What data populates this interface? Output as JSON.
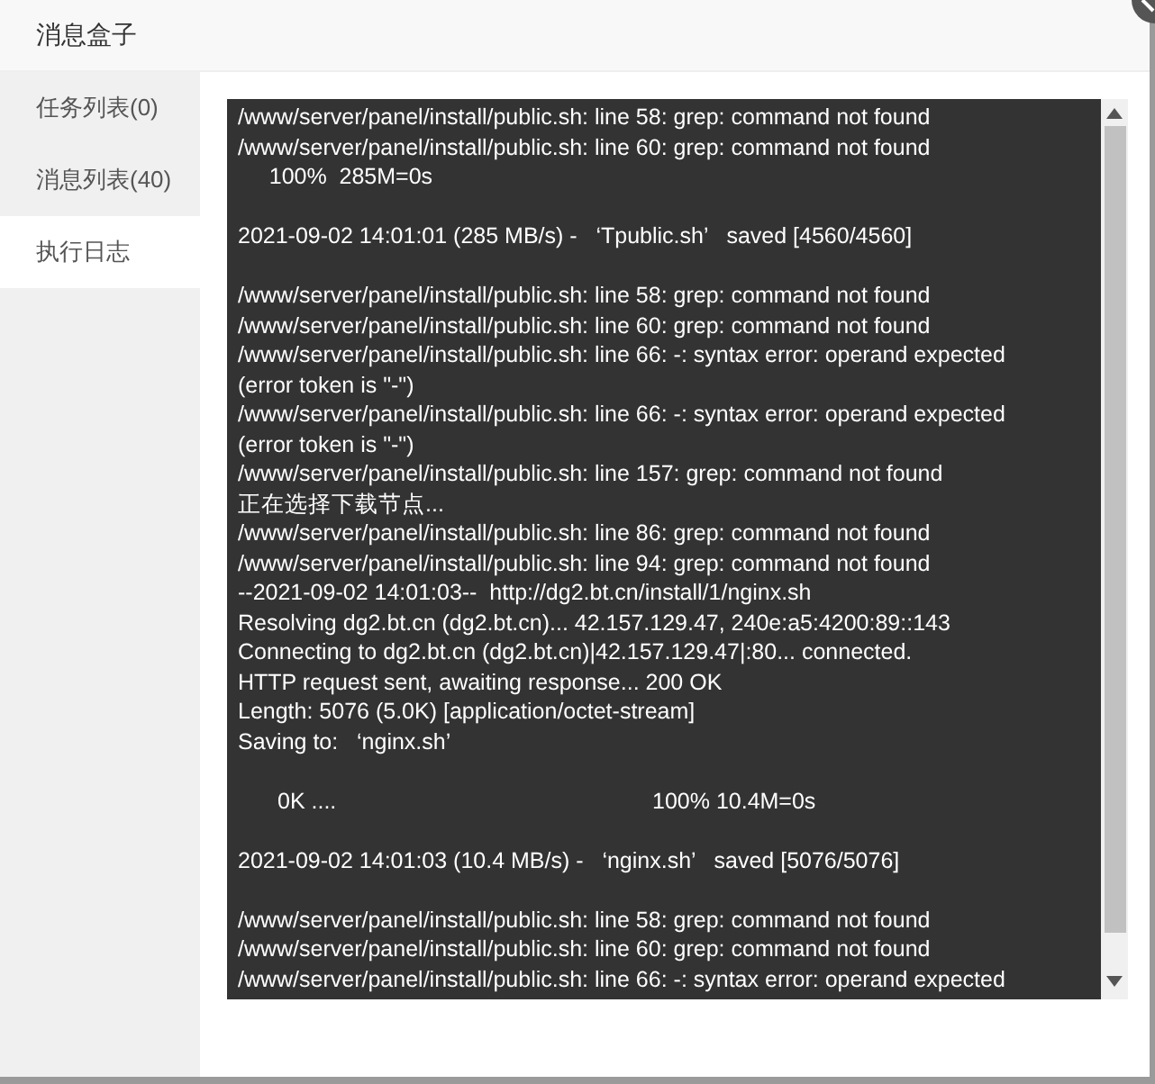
{
  "dialog": {
    "title": "消息盒子"
  },
  "sidebar": {
    "items": [
      {
        "label": "任务列表(0)",
        "selected": false
      },
      {
        "label": "消息列表(40)",
        "selected": false
      },
      {
        "label": "执行日志",
        "selected": true
      }
    ]
  },
  "log": {
    "blocks": [
      [
        "/www/server/panel/install/public.sh: line 58: grep: command not found",
        "/www/server/panel/install/public.sh: line 60: grep: command not found",
        "     100%  285M=0s"
      ],
      [
        "2021-09-02 14:01:01 (285 MB/s) -   ‘Tpublic.sh’   saved [4560/4560]"
      ],
      [
        "/www/server/panel/install/public.sh: line 58: grep: command not found",
        "/www/server/panel/install/public.sh: line 60: grep: command not found",
        "/www/server/panel/install/public.sh: line 66: -: syntax error: operand expected",
        "(error token is \"-\")",
        "/www/server/panel/install/public.sh: line 66: -: syntax error: operand expected",
        "(error token is \"-\")",
        "/www/server/panel/install/public.sh: line 157: grep: command not found",
        "正在选择下载节点...",
        "/www/server/panel/install/public.sh: line 86: grep: command not found",
        "/www/server/panel/install/public.sh: line 94: grep: command not found",
        "--2021-09-02 14:01:03--  http://dg2.bt.cn/install/1/nginx.sh",
        "Resolving dg2.bt.cn (dg2.bt.cn)... 42.157.129.47, 240e:a5:4200:89::143",
        "Connecting to dg2.bt.cn (dg2.bt.cn)|42.157.129.47|:80... connected.",
        "HTTP request sent, awaiting response... 200 OK",
        "Length: 5076 (5.0K) [application/octet-stream]",
        "Saving to:   ‘nginx.sh’"
      ],
      [
        [
          "0K ....",
          "100% 10.4M=0s"
        ]
      ],
      [
        "2021-09-02 14:01:03 (10.4 MB/s) -   ‘nginx.sh’   saved [5076/5076]"
      ],
      [
        "/www/server/panel/install/public.sh: line 58: grep: command not found",
        "/www/server/panel/install/public.sh: line 60: grep: command not found",
        "/www/server/panel/install/public.sh: line 66: -: syntax error: operand expected"
      ]
    ]
  }
}
